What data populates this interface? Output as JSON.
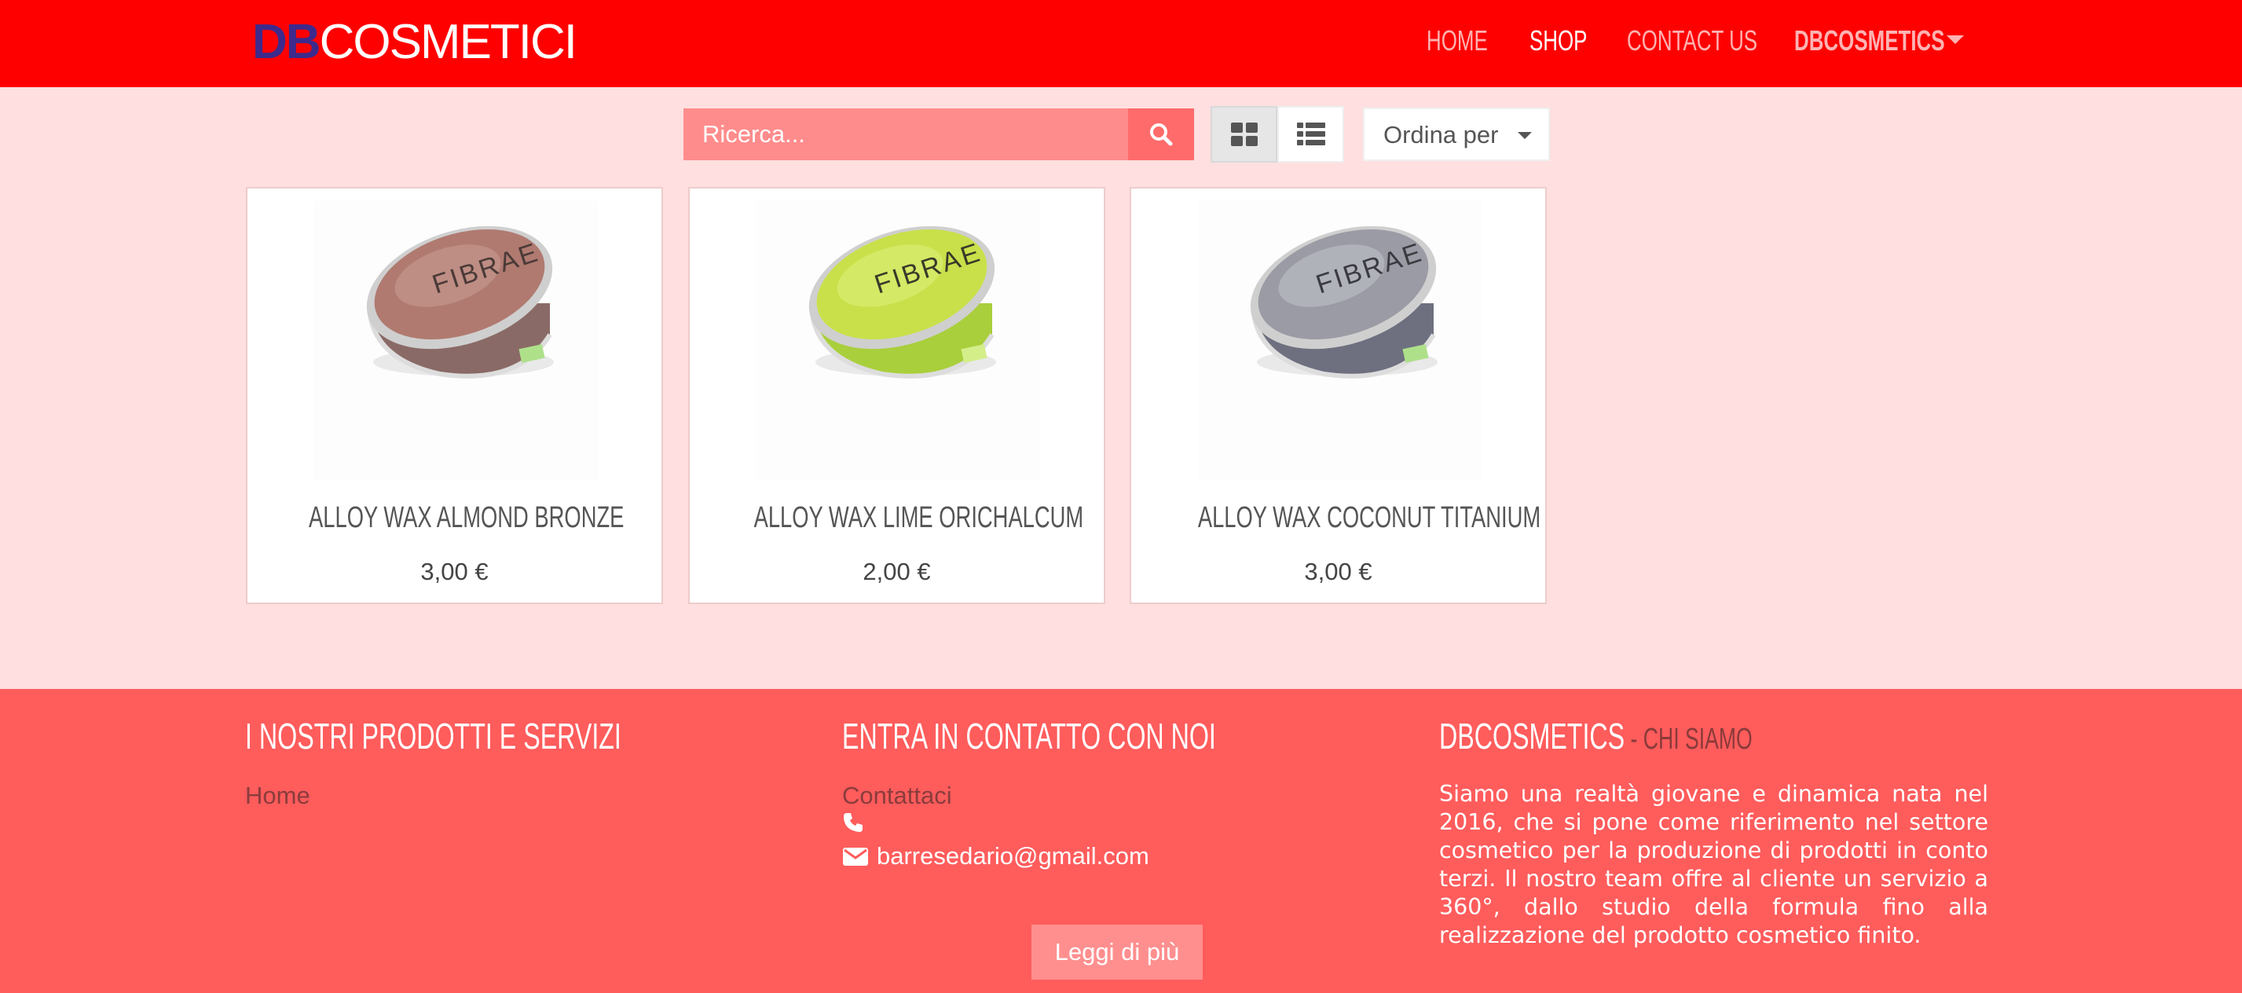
{
  "brand": {
    "part1": "DB",
    "part2": "COSMETICI"
  },
  "nav": {
    "items": [
      {
        "label": "HOME"
      },
      {
        "label": "SHOP"
      },
      {
        "label": "CONTACT US"
      },
      {
        "label": "DBCOSMETICS"
      }
    ],
    "active": "SHOP"
  },
  "toolbar": {
    "search_placeholder": "Ricerca...",
    "sort_label": "Ordina per",
    "view_mode": "grid"
  },
  "products": [
    {
      "name": "ALLOY WAX ALMOND BRONZE",
      "price": "3,00 €",
      "lid_color": "#b07a70",
      "icon": "wax-jar-bronze"
    },
    {
      "name": "ALLOY WAX LIME ORICHALCUM",
      "price": "2,00 €",
      "lid_color": "#c9e04a",
      "icon": "wax-jar-lime"
    },
    {
      "name": "ALLOY WAX COCONUT TITANIUM",
      "price": "3,00 €",
      "lid_color": "#8e8f98",
      "icon": "wax-jar-titanium"
    }
  ],
  "product_brand": "FIBRAE",
  "footer": {
    "col1": {
      "heading": "I NOSTRI PRODOTTI E SERVIZI",
      "links": [
        "Home"
      ]
    },
    "col2": {
      "heading": "ENTRA IN CONTATTO CON NOI",
      "contact_link": "Contattaci",
      "phone": "",
      "email": "barresedario@gmail.com"
    },
    "col3": {
      "heading": "DBCOSMETICS",
      "separator": " - ",
      "subheading": "CHI SIAMO",
      "text": "Siamo una realtà giovane e dinamica nata nel 2016, che si pone come riferimento nel settore cosmetico per la produzione di prodotti in conto terzi. Il nostro team offre al cliente un servizio a 360°, dallo studio della formula fino alla realizzazione del prodotto cosmetico finito."
    },
    "read_more": "Leggi di più"
  },
  "colors": {
    "navbar": "#ff0000",
    "page_bg": "#ffdfdf",
    "footer": "#ff5c5c",
    "brand_accent": "#3d2a8c"
  }
}
